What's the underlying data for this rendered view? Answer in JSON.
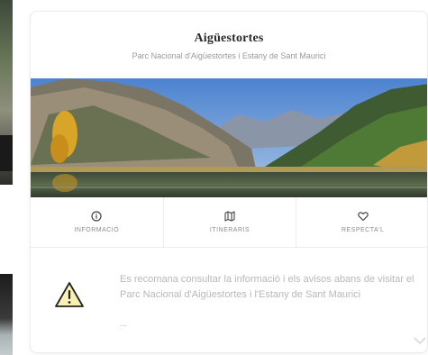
{
  "card": {
    "title": "Aigüestortes",
    "subtitle": "Parc Nacional d'Aigüestortes i Estany de Sant Maurici"
  },
  "tabs": [
    {
      "label": "INFORMACIÓ",
      "icon": "info-icon"
    },
    {
      "label": "ITINERARIS",
      "icon": "map-icon"
    },
    {
      "label": "RESPECTA'L",
      "icon": "heart-icon"
    }
  ],
  "notice": {
    "icon": "warning-icon",
    "text": "Es recomana consultar la informació i els avisos abans de visitar el Parc Nacional d'Aigüestortes i l'Estany de Sant Maurici",
    "ellipsis": "...",
    "expand_icon": "chevron-down-icon"
  },
  "colors": {
    "card_border": "#ececec",
    "title": "#2b2b2b",
    "muted_text": "#9a9a9a",
    "warning_fill": "#fbf0b4"
  }
}
